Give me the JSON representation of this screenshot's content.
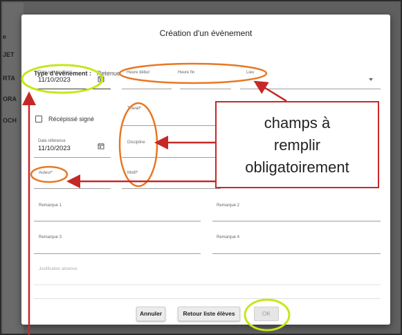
{
  "background_items": [
    "e",
    "JET",
    "RTA",
    "ORA",
    "OCH"
  ],
  "modal": {
    "title": "Création d'un évènement",
    "type_label": "Type d'évènement :",
    "type_value": "Retenue"
  },
  "fields": {
    "date_convocation": {
      "label": "Date convocation*",
      "value": "11/10/2023"
    },
    "heure_debut": {
      "label": "Heure début"
    },
    "heure_fin": {
      "label": "Heure fin"
    },
    "lieu": {
      "label": "Lieu"
    },
    "recepisse": {
      "label": "Récépissé signé",
      "checked": false
    },
    "travail": {
      "label": "Travail*"
    },
    "date_reference": {
      "label": "Date référence",
      "value": "11/10/2023"
    },
    "discipline": {
      "label": "Discipline"
    },
    "auteur": {
      "label": "Auteur*"
    },
    "motif": {
      "label": "Motif*"
    },
    "remarque1": {
      "label": "Remarque 1"
    },
    "remarque2": {
      "label": "Remarque 2"
    },
    "remarque3": {
      "label": "Remarque 3"
    },
    "remarque4": {
      "label": "Remarque 4"
    },
    "justification": {
      "label": "Justification absence"
    }
  },
  "buttons": {
    "cancel": "Annuler",
    "back": "Retour liste élèves",
    "ok": "OK"
  },
  "annotation": {
    "line1": "champs à",
    "line2": "remplir",
    "line3": "obligatoirement"
  },
  "colors": {
    "orange_highlight": "#e87722",
    "green_highlight": "#c6e619",
    "red_arrow": "#c62828"
  },
  "icons": [
    "calendar-icon",
    "chevron-down-icon",
    "checkbox-icon"
  ]
}
